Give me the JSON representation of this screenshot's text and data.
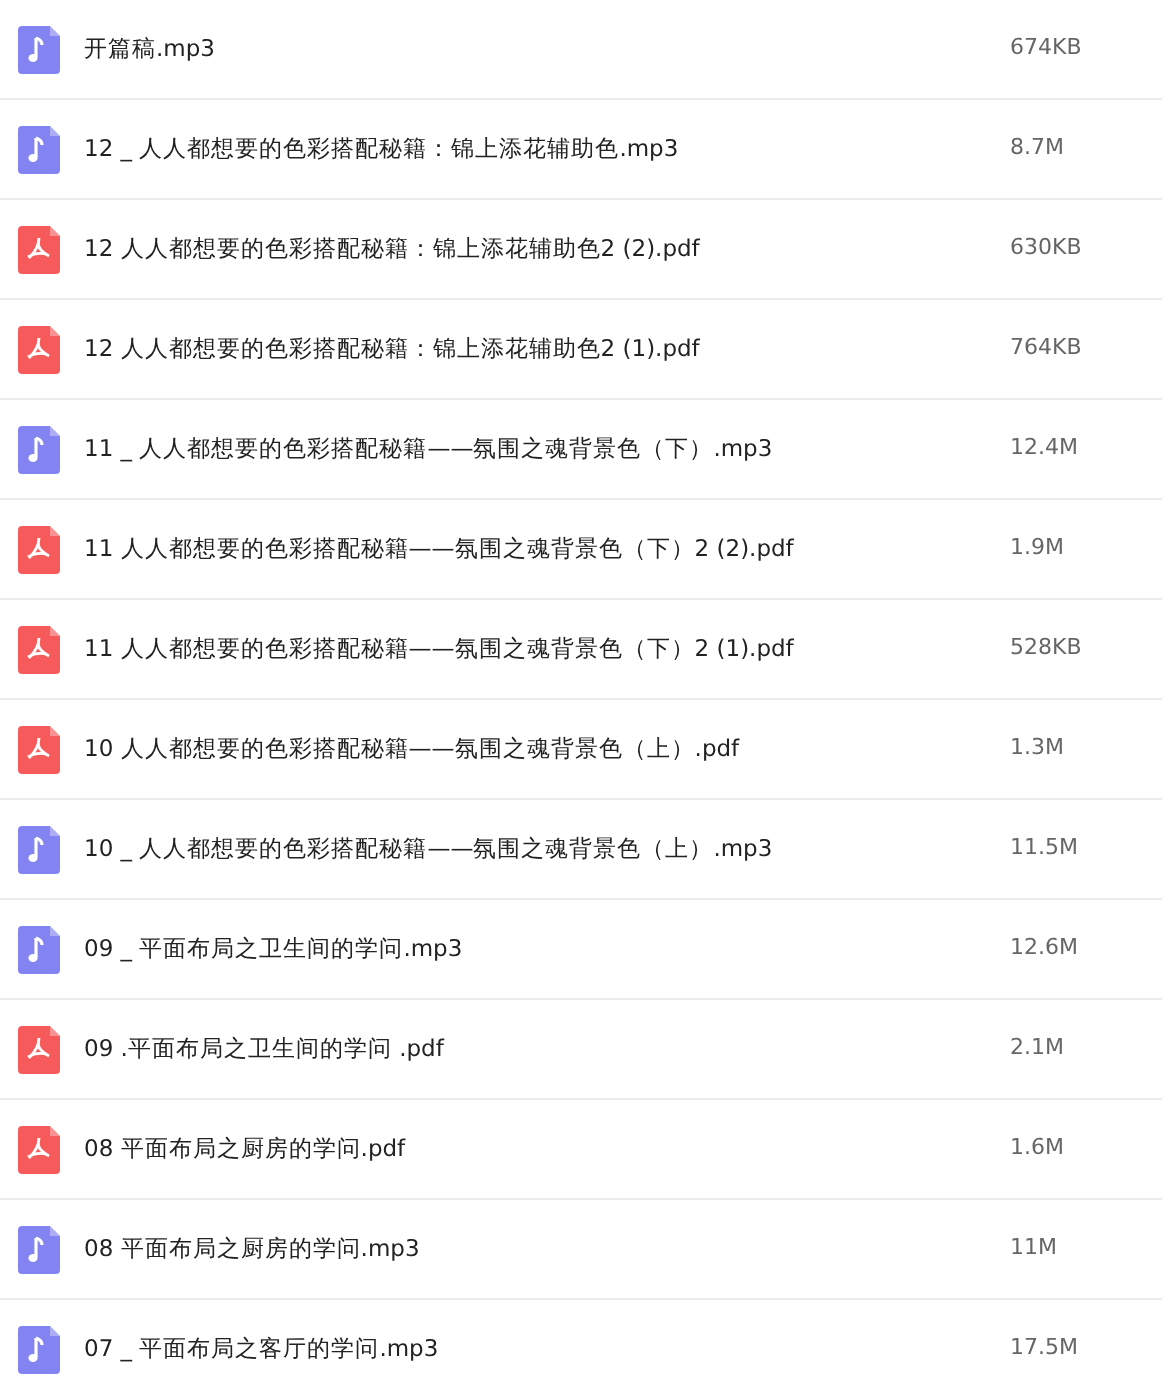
{
  "files": [
    {
      "kind": "audio",
      "name": "开篇稿.mp3",
      "size": "674KB"
    },
    {
      "kind": "audio",
      "name": "12 _ 人人都想要的色彩搭配秘籍：锦上添花辅助色.mp3",
      "size": "8.7M"
    },
    {
      "kind": "pdf",
      "name": "12 人人都想要的色彩搭配秘籍：锦上添花辅助色2 (2).pdf",
      "size": "630KB"
    },
    {
      "kind": "pdf",
      "name": "12 人人都想要的色彩搭配秘籍：锦上添花辅助色2 (1).pdf",
      "size": "764KB"
    },
    {
      "kind": "audio",
      "name": "11 _ 人人都想要的色彩搭配秘籍——氛围之魂背景色（下）.mp3",
      "size": "12.4M"
    },
    {
      "kind": "pdf",
      "name": "11 人人都想要的色彩搭配秘籍——氛围之魂背景色（下）2 (2).pdf",
      "size": "1.9M"
    },
    {
      "kind": "pdf",
      "name": "11 人人都想要的色彩搭配秘籍——氛围之魂背景色（下）2 (1).pdf",
      "size": "528KB"
    },
    {
      "kind": "pdf",
      "name": "10 人人都想要的色彩搭配秘籍——氛围之魂背景色（上）.pdf",
      "size": "1.3M"
    },
    {
      "kind": "audio",
      "name": "10 _ 人人都想要的色彩搭配秘籍——氛围之魂背景色（上）.mp3",
      "size": "11.5M"
    },
    {
      "kind": "audio",
      "name": "09 _ 平面布局之卫生间的学问.mp3",
      "size": "12.6M"
    },
    {
      "kind": "pdf",
      "name": "09 .平面布局之卫生间的学问 .pdf",
      "size": "2.1M"
    },
    {
      "kind": "pdf",
      "name": "08 平面布局之厨房的学问.pdf",
      "size": "1.6M"
    },
    {
      "kind": "audio",
      "name": "08 平面布局之厨房的学问.mp3",
      "size": "11M"
    },
    {
      "kind": "audio",
      "name": "07 _ 平面布局之客厅的学问.mp3",
      "size": "17.5M"
    }
  ]
}
